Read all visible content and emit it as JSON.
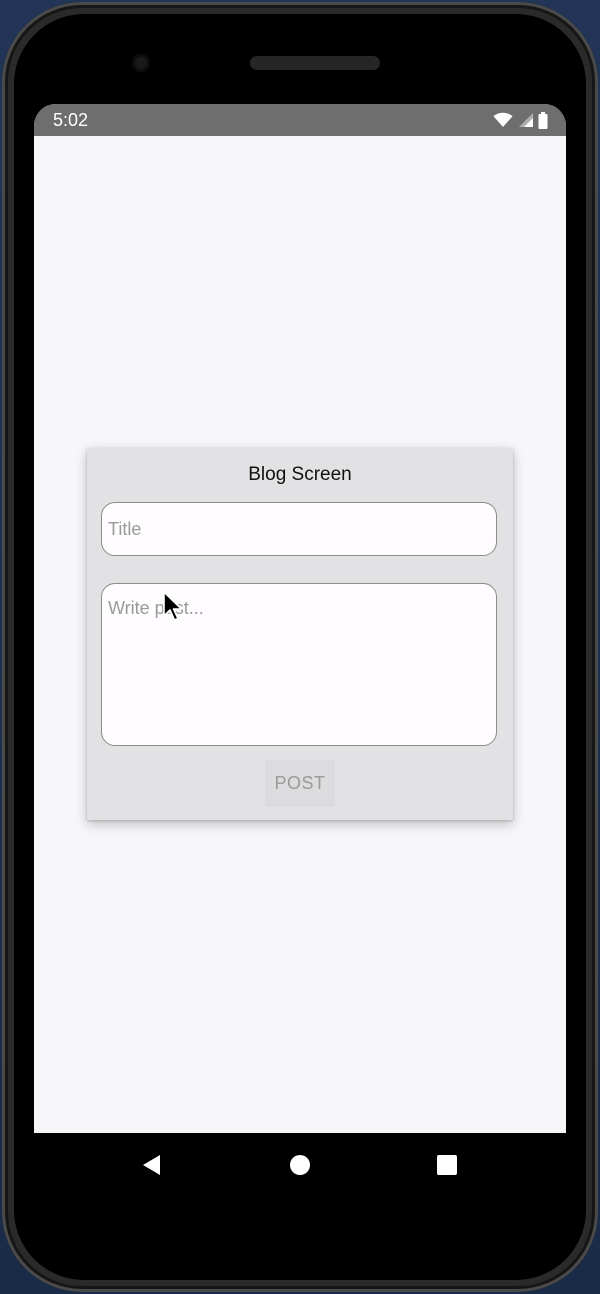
{
  "status_bar": {
    "time": "5:02",
    "icons": [
      "wifi-icon",
      "signal-icon",
      "battery-icon"
    ]
  },
  "blog_card": {
    "title": "Blog Screen",
    "title_input": {
      "placeholder": "Title",
      "value": ""
    },
    "post_input": {
      "placeholder": "Write post...",
      "value": ""
    },
    "post_button_label": "POST"
  },
  "navigation": {
    "buttons": [
      "back-icon",
      "home-icon",
      "recents-icon"
    ]
  },
  "colors": {
    "screen_background": "#f7f6f9",
    "card_background": "#e2e1e3",
    "status_bar": "#6e6e6e",
    "placeholder_text": "#9a9a9a"
  }
}
